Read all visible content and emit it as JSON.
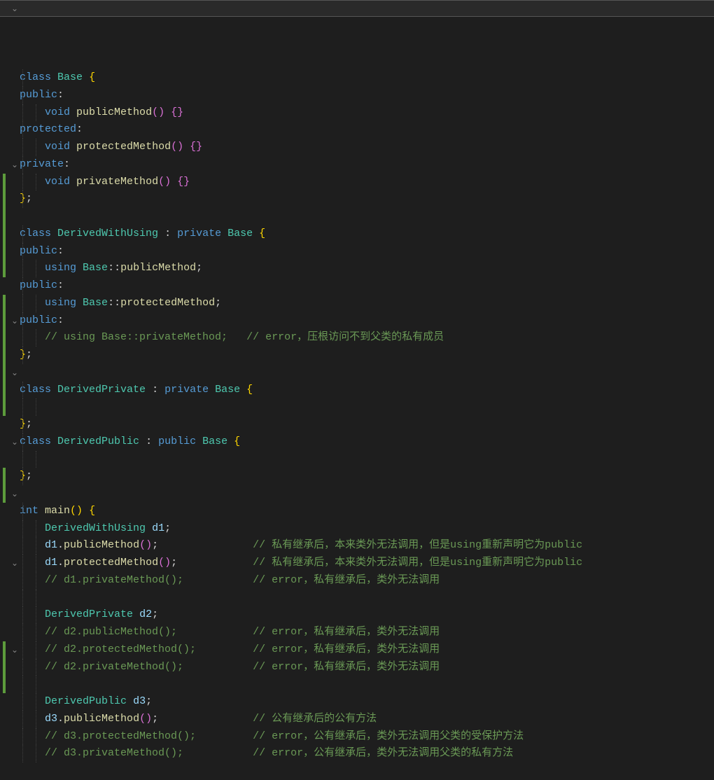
{
  "lines": [
    {
      "fold": "v",
      "indents": [
        0
      ],
      "tokens": [
        [
          "kw",
          "class"
        ],
        [
          "txt",
          " "
        ],
        [
          "type",
          "Base"
        ],
        [
          "txt",
          " "
        ],
        [
          "brace",
          "{"
        ]
      ],
      "hl": true
    },
    {
      "indents": [
        0
      ],
      "tokens": [
        [
          "kw",
          "public"
        ],
        [
          "punct",
          ":"
        ]
      ]
    },
    {
      "indents": [
        0,
        2
      ],
      "tokens": [
        [
          "txt",
          "    "
        ],
        [
          "kw",
          "void"
        ],
        [
          "txt",
          " "
        ],
        [
          "fn",
          "publicMethod"
        ],
        [
          "brace2",
          "()"
        ],
        [
          "txt",
          " "
        ],
        [
          "brace2",
          "{}"
        ]
      ]
    },
    {
      "indents": [
        0
      ],
      "tokens": [
        [
          "kw",
          "protected"
        ],
        [
          "punct",
          ":"
        ]
      ]
    },
    {
      "indents": [
        0,
        2
      ],
      "tokens": [
        [
          "txt",
          "    "
        ],
        [
          "kw",
          "void"
        ],
        [
          "txt",
          " "
        ],
        [
          "fn",
          "protectedMethod"
        ],
        [
          "brace2",
          "()"
        ],
        [
          "txt",
          " "
        ],
        [
          "brace2",
          "{}"
        ]
      ]
    },
    {
      "indents": [
        0
      ],
      "tokens": [
        [
          "kw",
          "private"
        ],
        [
          "punct",
          ":"
        ]
      ]
    },
    {
      "indents": [
        0,
        2
      ],
      "tokens": [
        [
          "txt",
          "    "
        ],
        [
          "kw",
          "void"
        ],
        [
          "txt",
          " "
        ],
        [
          "fn",
          "privateMethod"
        ],
        [
          "brace2",
          "()"
        ],
        [
          "txt",
          " "
        ],
        [
          "brace2",
          "{}"
        ]
      ]
    },
    {
      "indents": [
        0
      ],
      "tokens": [
        [
          "brace",
          "}"
        ],
        [
          "punct",
          ";"
        ]
      ]
    },
    {
      "tokens": []
    },
    {
      "fold": "v",
      "indents": [
        0
      ],
      "tokens": [
        [
          "kw",
          "class"
        ],
        [
          "txt",
          " "
        ],
        [
          "type",
          "DerivedWithUsing"
        ],
        [
          "txt",
          " "
        ],
        [
          "punct",
          ":"
        ],
        [
          "txt",
          " "
        ],
        [
          "kw",
          "private"
        ],
        [
          "txt",
          " "
        ],
        [
          "type",
          "Base"
        ],
        [
          "txt",
          " "
        ],
        [
          "brace",
          "{"
        ]
      ]
    },
    {
      "bar": true,
      "indents": [
        0
      ],
      "tokens": [
        [
          "kw",
          "public"
        ],
        [
          "punct",
          ":"
        ]
      ]
    },
    {
      "bar": true,
      "indents": [
        0,
        2
      ],
      "tokens": [
        [
          "txt",
          "    "
        ],
        [
          "kw",
          "using"
        ],
        [
          "txt",
          " "
        ],
        [
          "type",
          "Base"
        ],
        [
          "punct",
          "::"
        ],
        [
          "fn",
          "publicMethod"
        ],
        [
          "punct",
          ";"
        ]
      ]
    },
    {
      "bar": true,
      "indents": [
        0
      ],
      "tokens": [
        [
          "kw",
          "public"
        ],
        [
          "punct",
          ":"
        ]
      ]
    },
    {
      "bar": true,
      "indents": [
        0,
        2
      ],
      "tokens": [
        [
          "txt",
          "    "
        ],
        [
          "kw",
          "using"
        ],
        [
          "txt",
          " "
        ],
        [
          "type",
          "Base"
        ],
        [
          "punct",
          "::"
        ],
        [
          "fn",
          "protectedMethod"
        ],
        [
          "punct",
          ";"
        ]
      ]
    },
    {
      "bar": true,
      "indents": [
        0
      ],
      "tokens": [
        [
          "kw",
          "public"
        ],
        [
          "punct",
          ":"
        ]
      ]
    },
    {
      "bar": true,
      "indents": [
        0,
        2
      ],
      "tokens": [
        [
          "txt",
          "    "
        ],
        [
          "comment",
          "// using Base::privateMethod;   // error，压根访问不到父类的私有成员"
        ]
      ]
    },
    {
      "indents": [
        0
      ],
      "tokens": [
        [
          "brace",
          "}"
        ],
        [
          "punct",
          ";"
        ]
      ]
    },
    {
      "bar": true,
      "tokens": []
    },
    {
      "fold": "v",
      "bar": true,
      "indents": [
        0
      ],
      "tokens": [
        [
          "kw",
          "class"
        ],
        [
          "txt",
          " "
        ],
        [
          "type",
          "DerivedPrivate"
        ],
        [
          "txt",
          " "
        ],
        [
          "punct",
          ":"
        ],
        [
          "txt",
          " "
        ],
        [
          "kw",
          "private"
        ],
        [
          "txt",
          " "
        ],
        [
          "type",
          "Base"
        ],
        [
          "txt",
          " "
        ],
        [
          "brace",
          "{"
        ]
      ]
    },
    {
      "bar": true,
      "indents": [
        0,
        2
      ],
      "tokens": []
    },
    {
      "bar": true,
      "indents": [
        0
      ],
      "tokens": [
        [
          "brace",
          "}"
        ],
        [
          "punct",
          ";"
        ]
      ]
    },
    {
      "fold": "v",
      "bar": true,
      "indents": [
        0
      ],
      "tokens": [
        [
          "kw",
          "class"
        ],
        [
          "txt",
          " "
        ],
        [
          "type",
          "DerivedPublic"
        ],
        [
          "txt",
          " "
        ],
        [
          "punct",
          ":"
        ],
        [
          "txt",
          " "
        ],
        [
          "kw",
          "public"
        ],
        [
          "txt",
          " "
        ],
        [
          "type",
          "Base"
        ],
        [
          "txt",
          " "
        ],
        [
          "brace",
          "{"
        ]
      ]
    },
    {
      "bar": true,
      "indents": [
        0,
        2
      ],
      "tokens": []
    },
    {
      "bar": true,
      "indents": [
        0
      ],
      "tokens": [
        [
          "brace",
          "}"
        ],
        [
          "punct",
          ";"
        ]
      ]
    },
    {
      "tokens": []
    },
    {
      "fold": "v",
      "indents": [
        0
      ],
      "tokens": [
        [
          "kw",
          "int"
        ],
        [
          "txt",
          " "
        ],
        [
          "fn",
          "main"
        ],
        [
          "brace",
          "()"
        ],
        [
          "txt",
          " "
        ],
        [
          "brace",
          "{"
        ]
      ]
    },
    {
      "indents": [
        0,
        2
      ],
      "tokens": [
        [
          "txt",
          "    "
        ],
        [
          "type",
          "DerivedWithUsing"
        ],
        [
          "txt",
          " "
        ],
        [
          "var",
          "d1"
        ],
        [
          "punct",
          ";"
        ]
      ]
    },
    {
      "bar": true,
      "indents": [
        0,
        2
      ],
      "tokens": [
        [
          "txt",
          "    "
        ],
        [
          "var",
          "d1"
        ],
        [
          "punct",
          "."
        ],
        [
          "fn",
          "publicMethod"
        ],
        [
          "brace2",
          "()"
        ],
        [
          "punct",
          ";"
        ],
        [
          "txt",
          "               "
        ],
        [
          "comment",
          "// 私有继承后，本来类外无法调用，但是using重新声明它为public"
        ]
      ]
    },
    {
      "fold": "v",
      "bar": true,
      "indents": [
        0,
        2
      ],
      "tokens": [
        [
          "txt",
          "    "
        ],
        [
          "var",
          "d1"
        ],
        [
          "punct",
          "."
        ],
        [
          "fn",
          "protectedMethod"
        ],
        [
          "brace2",
          "()"
        ],
        [
          "punct",
          ";"
        ],
        [
          "txt",
          "            "
        ],
        [
          "comment",
          "// 私有继承后，本来类外无法调用，但是using重新声明它为public"
        ]
      ]
    },
    {
      "indents": [
        0,
        2
      ],
      "tokens": [
        [
          "txt",
          "    "
        ],
        [
          "comment",
          "// d1.privateMethod();           // error，私有继承后，类外无法调用"
        ]
      ]
    },
    {
      "indents": [
        0,
        2
      ],
      "tokens": []
    },
    {
      "indents": [
        0,
        2
      ],
      "tokens": [
        [
          "txt",
          "    "
        ],
        [
          "type",
          "DerivedPrivate"
        ],
        [
          "txt",
          " "
        ],
        [
          "var",
          "d2"
        ],
        [
          "punct",
          ";"
        ]
      ]
    },
    {
      "fold": "v",
      "indents": [
        0,
        2
      ],
      "tokens": [
        [
          "txt",
          "    "
        ],
        [
          "comment",
          "// d2.publicMethod();            // error，私有继承后，类外无法调用"
        ]
      ]
    },
    {
      "indents": [
        0,
        2
      ],
      "tokens": [
        [
          "txt",
          "    "
        ],
        [
          "comment",
          "// d2.protectedMethod();         // error，私有继承后，类外无法调用"
        ]
      ]
    },
    {
      "indents": [
        0,
        2
      ],
      "tokens": [
        [
          "txt",
          "    "
        ],
        [
          "comment",
          "// d2.privateMethod();           // error，私有继承后，类外无法调用"
        ]
      ]
    },
    {
      "indents": [
        0,
        2
      ],
      "tokens": []
    },
    {
      "indents": [
        0,
        2
      ],
      "tokens": [
        [
          "txt",
          "    "
        ],
        [
          "type",
          "DerivedPublic"
        ],
        [
          "txt",
          " "
        ],
        [
          "var",
          "d3"
        ],
        [
          "punct",
          ";"
        ]
      ]
    },
    {
      "fold": "v",
      "bar": true,
      "indents": [
        0,
        2
      ],
      "tokens": [
        [
          "txt",
          "    "
        ],
        [
          "var",
          "d3"
        ],
        [
          "punct",
          "."
        ],
        [
          "fn",
          "publicMethod"
        ],
        [
          "brace2",
          "()"
        ],
        [
          "punct",
          ";"
        ],
        [
          "txt",
          "               "
        ],
        [
          "comment",
          "// 公有继承后的公有方法"
        ]
      ]
    },
    {
      "bar": true,
      "indents": [
        0,
        2
      ],
      "tokens": [
        [
          "txt",
          "    "
        ],
        [
          "comment",
          "// d3.protectedMethod();         // error，公有继承后，类外无法调用父类的受保护方法"
        ]
      ]
    },
    {
      "bar": true,
      "indents": [
        0,
        2
      ],
      "tokens": [
        [
          "txt",
          "    "
        ],
        [
          "comment",
          "// d3.privateMethod();           // error，公有继承后，类外无法调用父类的私有方法"
        ]
      ]
    }
  ]
}
